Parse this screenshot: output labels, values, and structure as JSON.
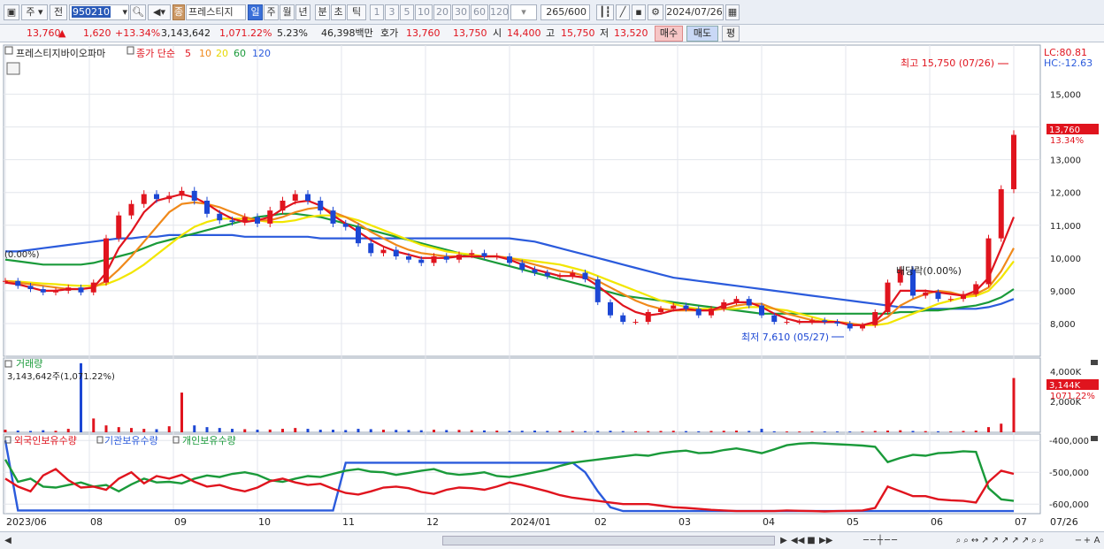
{
  "toolbar": {
    "market": "주",
    "prev": "전",
    "code": "950210",
    "stock_badge": "종",
    "stock_name": "프레스티지",
    "periods": [
      "일",
      "주",
      "월",
      "년",
      "분",
      "초",
      "틱"
    ],
    "selected_period": "일",
    "intervals": [
      "1",
      "3",
      "5",
      "10",
      "20",
      "30",
      "60",
      "120"
    ],
    "count": "265",
    "count_max": "/600",
    "date": "2024/07/26"
  },
  "quote": {
    "price": "13,760",
    "change_arrow": "▲",
    "change": "1,620",
    "change_pct": "+13.34%",
    "volume": "3,143,642",
    "volume_pct": "1,071.22%",
    "turnover": "5.23%",
    "amount": "46,398백만",
    "hoga_label": "호가",
    "ask": "13,760",
    "bid": "13,750",
    "open_label": "시",
    "open": "14,400",
    "high_label": "고",
    "high": "15,750",
    "low_label": "저",
    "low": "13,520",
    "buy_btn": "매수",
    "sell_btn": "매도",
    "eval_btn": "평"
  },
  "price_panel": {
    "stock_label": "프레스티지바이오파마",
    "ma_label": "종가 단순",
    "ma_periods": [
      "5",
      "10",
      "20",
      "60",
      "120"
    ],
    "ma_colors": [
      "#e0141e",
      "#f0891a",
      "#f2e600",
      "#1a9a3a",
      "#2b5bdc"
    ],
    "lc": "LC:80.81",
    "hc": "HC:-12.63",
    "max_annotation": "최고 15,750 (07/26)",
    "min_annotation": "최저 7,610 (05/27)",
    "dividend_annotation": "배당락(0.00%)",
    "left_pct": "(0.00%)",
    "current_price_tag": "13,760",
    "current_pct_tag": "13.34%"
  },
  "volume_panel": {
    "title": "거래량",
    "value_text": "3,143,642주(1,071.22%)",
    "axis_top": "4,000K",
    "axis_mid": "2,000K",
    "tag_value": "3,144K",
    "tag_pct": "1071.22%"
  },
  "holdings_panel": {
    "series": [
      "외국인보유수량",
      "기관보유수량",
      "개인보유수량"
    ],
    "series_colors": [
      "#e0141e",
      "#2b5bdc",
      "#1a9a3a"
    ]
  },
  "chart_data": {
    "type": "candlestick",
    "price_axis": {
      "ticks": [
        8000,
        9000,
        10000,
        11000,
        12000,
        13000,
        14000,
        15000
      ],
      "labels": [
        "8,000",
        "9,000",
        "10,000",
        "11,000",
        "12,000",
        "13,000",
        "14,000",
        "15,000"
      ],
      "range": [
        7000,
        16500
      ]
    },
    "volume_axis": {
      "ticks": [
        2000,
        4000
      ],
      "labels": [
        "2,000K",
        "4,000K"
      ],
      "range": [
        0,
        4300
      ]
    },
    "holdings_axis": {
      "ticks": [
        -400000,
        -500000,
        -600000
      ],
      "labels": [
        "-400,000",
        "-500,000",
        "-600,000"
      ],
      "range": [
        -630000,
        -380000
      ]
    },
    "x_labels": [
      "2023/06",
      "08",
      "09",
      "10",
      "11",
      "12",
      "2024/01",
      "02",
      "03",
      "04",
      "05",
      "06",
      "07",
      "07/26"
    ],
    "close": [
      9300,
      9150,
      9050,
      8950,
      9000,
      9100,
      8950,
      9250,
      10600,
      11300,
      11650,
      11950,
      11800,
      11900,
      12050,
      11750,
      11350,
      11150,
      11100,
      11250,
      11050,
      11450,
      11750,
      11950,
      11750,
      11450,
      11050,
      10950,
      10450,
      10150,
      10250,
      10050,
      9950,
      9850,
      10050,
      9950,
      10100,
      10150,
      10050,
      10050,
      9850,
      9650,
      9550,
      9450,
      9450,
      9550,
      9350,
      8650,
      8250,
      8050,
      8050,
      8350,
      8450,
      8550,
      8450,
      8250,
      8450,
      8650,
      8750,
      8550,
      8250,
      8050,
      8050,
      8050,
      8100,
      8050,
      8000,
      7850,
      7950,
      8350,
      9250,
      9650,
      8850,
      8950,
      8750,
      8750,
      8900,
      9200,
      10600,
      12100,
      13760
    ],
    "ma5": [
      9250,
      9200,
      9100,
      9000,
      9000,
      9050,
      9050,
      9100,
      9550,
      10300,
      10800,
      11400,
      11750,
      11850,
      11950,
      11850,
      11650,
      11400,
      11200,
      11100,
      11150,
      11250,
      11500,
      11700,
      11750,
      11600,
      11300,
      11050,
      10800,
      10550,
      10350,
      10200,
      10100,
      10000,
      10000,
      10000,
      10050,
      10050,
      10050,
      10050,
      9950,
      9800,
      9650,
      9550,
      9450,
      9450,
      9400,
      9150,
      8850,
      8550,
      8350,
      8250,
      8300,
      8400,
      8450,
      8400,
      8400,
      8550,
      8650,
      8650,
      8500,
      8300,
      8150,
      8050,
      8050,
      8050,
      8050,
      7950,
      7950,
      8050,
      8450,
      9000,
      9000,
      9000,
      8950,
      8900,
      8850,
      9000,
      9400,
      10300,
      11250
    ],
    "ma10": [
      9300,
      9250,
      9200,
      9150,
      9100,
      9050,
      9050,
      9100,
      9300,
      9650,
      10050,
      10500,
      10950,
      11400,
      11650,
      11700,
      11650,
      11550,
      11400,
      11250,
      11150,
      11150,
      11250,
      11400,
      11500,
      11550,
      11400,
      11250,
      11050,
      10800,
      10600,
      10400,
      10250,
      10150,
      10100,
      10050,
      10050,
      10050,
      10050,
      10050,
      10000,
      9900,
      9800,
      9700,
      9600,
      9550,
      9450,
      9300,
      9100,
      8900,
      8700,
      8550,
      8450,
      8400,
      8400,
      8400,
      8400,
      8450,
      8550,
      8600,
      8600,
      8450,
      8300,
      8200,
      8100,
      8050,
      8050,
      8000,
      7950,
      8000,
      8200,
      8550,
      8750,
      8900,
      9000,
      8950,
      8850,
      8900,
      9100,
      9600,
      10300
    ],
    "ma20": [
      9300,
      9280,
      9250,
      9220,
      9200,
      9170,
      9150,
      9150,
      9200,
      9350,
      9550,
      9800,
      10100,
      10400,
      10700,
      10950,
      11100,
      11200,
      11200,
      11200,
      11150,
      11100,
      11100,
      11150,
      11250,
      11300,
      11300,
      11250,
      11150,
      11000,
      10850,
      10700,
      10550,
      10400,
      10300,
      10200,
      10150,
      10100,
      10050,
      10050,
      10000,
      9950,
      9900,
      9850,
      9800,
      9700,
      9600,
      9450,
      9300,
      9150,
      9000,
      8850,
      8700,
      8600,
      8500,
      8450,
      8450,
      8450,
      8450,
      8500,
      8500,
      8450,
      8400,
      8300,
      8200,
      8100,
      8050,
      8000,
      7950,
      7950,
      8000,
      8150,
      8300,
      8450,
      8600,
      8700,
      8800,
      8850,
      9000,
      9400,
      9900
    ],
    "ma60": [
      9950,
      9900,
      9850,
      9800,
      9800,
      9800,
      9800,
      9850,
      9950,
      10050,
      10150,
      10300,
      10450,
      10550,
      10650,
      10750,
      10850,
      10950,
      11050,
      11150,
      11250,
      11300,
      11350,
      11350,
      11300,
      11250,
      11150,
      11050,
      10950,
      10850,
      10750,
      10650,
      10550,
      10450,
      10350,
      10250,
      10150,
      10050,
      9950,
      9850,
      9750,
      9650,
      9550,
      9450,
      9350,
      9250,
      9150,
      9050,
      8950,
      8850,
      8800,
      8750,
      8700,
      8650,
      8600,
      8550,
      8500,
      8450,
      8400,
      8350,
      8300,
      8300,
      8300,
      8300,
      8300,
      8300,
      8300,
      8300,
      8300,
      8300,
      8300,
      8350,
      8350,
      8400,
      8400,
      8450,
      8500,
      8550,
      8650,
      8800,
      9050
    ],
    "ma120": [
      10200,
      10200,
      10250,
      10300,
      10350,
      10400,
      10450,
      10500,
      10550,
      10600,
      10600,
      10650,
      10650,
      10700,
      10700,
      10700,
      10700,
      10700,
      10700,
      10650,
      10650,
      10650,
      10650,
      10650,
      10650,
      10600,
      10600,
      10600,
      10600,
      10600,
      10600,
      10600,
      10600,
      10600,
      10600,
      10600,
      10600,
      10600,
      10600,
      10600,
      10600,
      10550,
      10500,
      10400,
      10300,
      10200,
      10100,
      10000,
      9900,
      9800,
      9700,
      9600,
      9500,
      9400,
      9350,
      9300,
      9250,
      9200,
      9150,
      9100,
      9050,
      9000,
      8950,
      8900,
      8850,
      8800,
      8750,
      8700,
      8650,
      8600,
      8550,
      8500,
      8500,
      8450,
      8450,
      8450,
      8450,
      8450,
      8500,
      8600,
      8750
    ],
    "volume_k": [
      150,
      100,
      80,
      120,
      90,
      200,
      4000,
      800,
      400,
      300,
      250,
      200,
      180,
      350,
      2300,
      400,
      300,
      250,
      200,
      180,
      150,
      160,
      200,
      250,
      200,
      150,
      150,
      130,
      200,
      180,
      150,
      140,
      130,
      120,
      150,
      130,
      140,
      120,
      110,
      100,
      90,
      90,
      100,
      80,
      90,
      80,
      70,
      80,
      90,
      70,
      60,
      70,
      80,
      90,
      70,
      60,
      80,
      90,
      100,
      80,
      200,
      60,
      50,
      50,
      60,
      50,
      50,
      50,
      60,
      80,
      100,
      120,
      80,
      70,
      60,
      60,
      80,
      100,
      300,
      500,
      3144
    ],
    "foreign": [
      -520000,
      -545000,
      -560000,
      -510000,
      -490000,
      -525000,
      -548000,
      -545000,
      -555000,
      -520000,
      -500000,
      -535000,
      -512000,
      -520000,
      -508000,
      -530000,
      -545000,
      -540000,
      -552000,
      -560000,
      -548000,
      -528000,
      -520000,
      -532000,
      -540000,
      -536000,
      -552000,
      -565000,
      -570000,
      -560000,
      -548000,
      -545000,
      -550000,
      -562000,
      -568000,
      -555000,
      -548000,
      -550000,
      -555000,
      -545000,
      -532000,
      -540000,
      -550000,
      -560000,
      -572000,
      -580000,
      -585000,
      -590000,
      -595000,
      -600000,
      -600000,
      -600000,
      -605000,
      -610000,
      -612000,
      -615000,
      -618000,
      -620000,
      -622000,
      -622000,
      -622000,
      -622000,
      -620000,
      -621000,
      -622000,
      -623000,
      -622000,
      -621000,
      -620000,
      -612000,
      -545000,
      -560000,
      -575000,
      -575000,
      -585000,
      -588000,
      -590000,
      -595000,
      -530000,
      -495000,
      -505000
    ],
    "institution": [
      -400000,
      -620000,
      -620000,
      -620000,
      -620000,
      -620000,
      -620000,
      -620000,
      -620000,
      -620000,
      -620000,
      -620000,
      -620000,
      -620000,
      -620000,
      -620000,
      -620000,
      -620000,
      -620000,
      -620000,
      -620000,
      -620000,
      -620000,
      -620000,
      -620000,
      -620000,
      -620000,
      -470000,
      -470000,
      -470000,
      -470000,
      -470000,
      -470000,
      -470000,
      -470000,
      -470000,
      -470000,
      -470000,
      -470000,
      -470000,
      -470000,
      -470000,
      -470000,
      -470000,
      -470000,
      -470000,
      -500000,
      -560000,
      -610000,
      -622000,
      -622000,
      -622000,
      -622000,
      -622000,
      -622000,
      -622000,
      -622000,
      -622000,
      -622000,
      -622000,
      -622000,
      -622000,
      -622000,
      -622000,
      -622000,
      -622000,
      -622000,
      -622000,
      -622000,
      -622000,
      -622000,
      -622000,
      -622000,
      -622000,
      -622000,
      -622000,
      -622000,
      -622000,
      -622000,
      -622000,
      -622000
    ],
    "individual": [
      -460000,
      -530000,
      -520000,
      -545000,
      -548000,
      -540000,
      -532000,
      -545000,
      -540000,
      -560000,
      -538000,
      -520000,
      -532000,
      -530000,
      -535000,
      -520000,
      -510000,
      -515000,
      -505000,
      -500000,
      -508000,
      -525000,
      -530000,
      -520000,
      -512000,
      -515000,
      -505000,
      -495000,
      -490000,
      -498000,
      -500000,
      -508000,
      -502000,
      -495000,
      -490000,
      -503000,
      -508000,
      -505000,
      -500000,
      -512000,
      -515000,
      -508000,
      -500000,
      -492000,
      -480000,
      -470000,
      -465000,
      -460000,
      -455000,
      -450000,
      -445000,
      -448000,
      -440000,
      -435000,
      -432000,
      -440000,
      -438000,
      -430000,
      -425000,
      -432000,
      -440000,
      -428000,
      -415000,
      -410000,
      -408000,
      -410000,
      -412000,
      -414000,
      -416000,
      -420000,
      -468000,
      -455000,
      -445000,
      -448000,
      -440000,
      -438000,
      -434000,
      -436000,
      -550000,
      -585000,
      -590000
    ]
  }
}
